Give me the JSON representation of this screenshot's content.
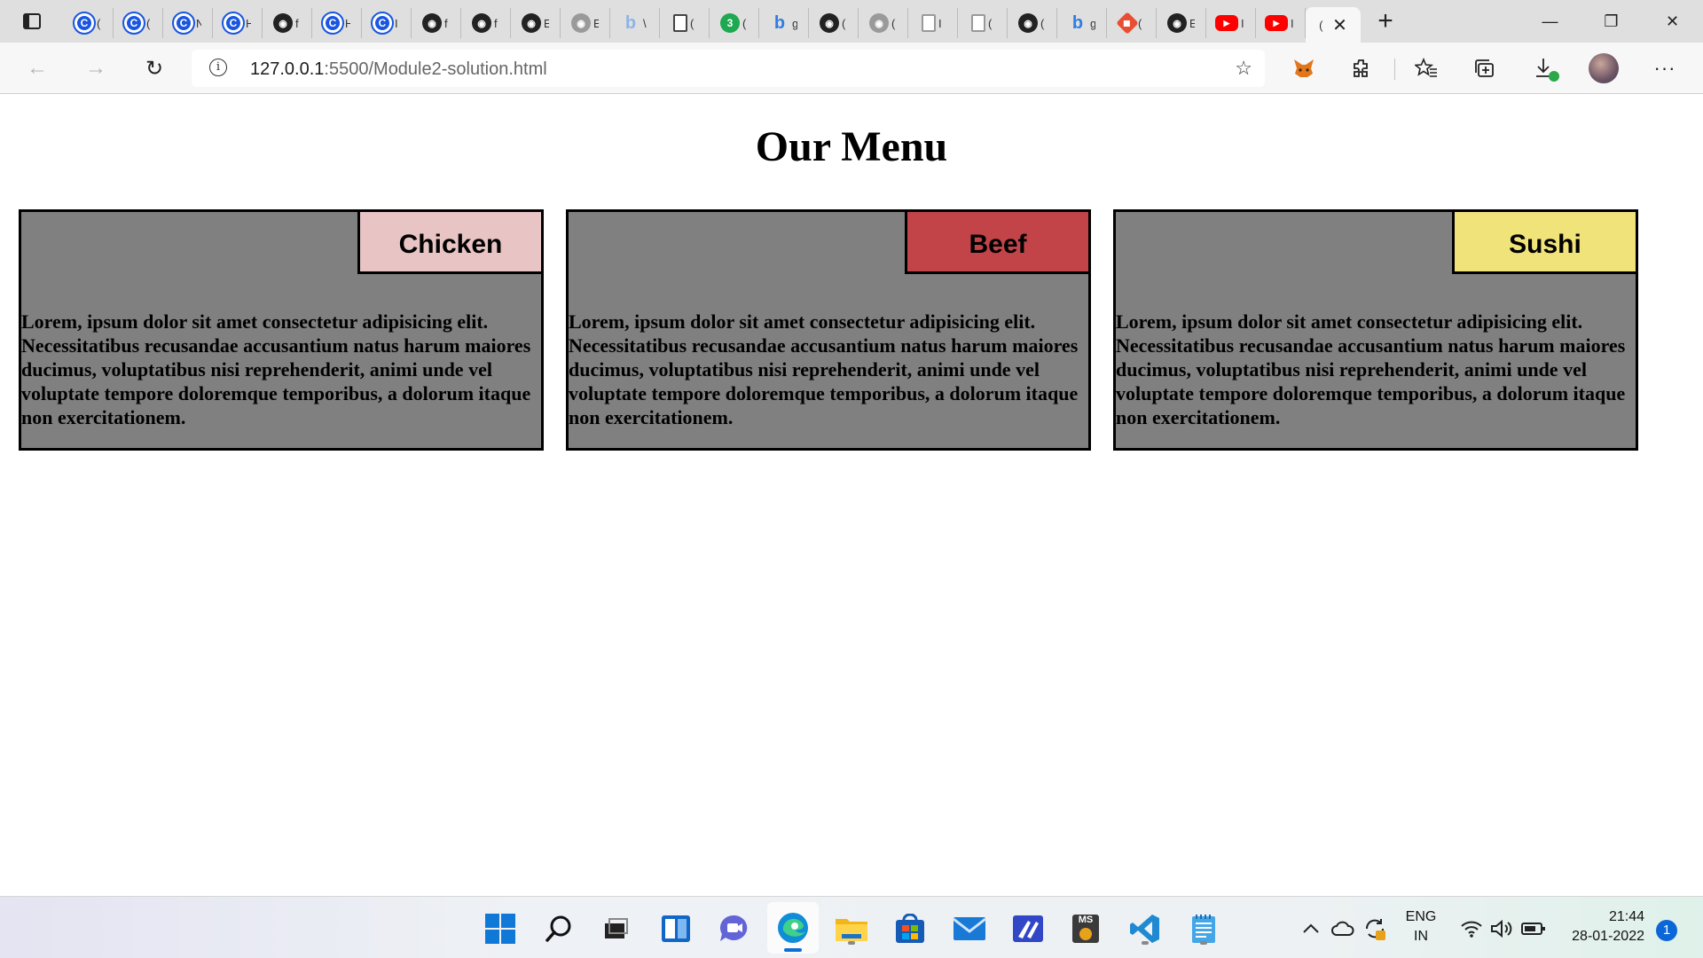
{
  "browser": {
    "tabs": [
      {
        "icon": "chrome-icon",
        "glyph": "C",
        "stub": "("
      },
      {
        "icon": "chrome-icon",
        "glyph": "C",
        "stub": "("
      },
      {
        "icon": "chrome-icon",
        "glyph": "C",
        "stub": "N"
      },
      {
        "icon": "chrome-icon",
        "glyph": "C",
        "stub": "H"
      },
      {
        "icon": "github-icon",
        "glyph": "◉",
        "stub": "f"
      },
      {
        "icon": "chrome-icon",
        "glyph": "C",
        "stub": "H"
      },
      {
        "icon": "chrome-icon",
        "glyph": "C",
        "stub": "I"
      },
      {
        "icon": "github-icon",
        "glyph": "◉",
        "stub": "f"
      },
      {
        "icon": "github-icon",
        "glyph": "◉",
        "stub": "f"
      },
      {
        "icon": "github-icon",
        "glyph": "◉",
        "stub": "E"
      },
      {
        "icon": "github-grey-icon",
        "glyph": "◉",
        "stub": "E"
      },
      {
        "icon": "bing-grey-icon",
        "glyph": "b",
        "stub": "\\"
      },
      {
        "icon": "document-icon",
        "glyph": "",
        "stub": "("
      },
      {
        "icon": "whatsapp-icon",
        "glyph": "3",
        "stub": "("
      },
      {
        "icon": "bing-icon",
        "glyph": "b",
        "stub": "g"
      },
      {
        "icon": "github-icon",
        "glyph": "◉",
        "stub": "("
      },
      {
        "icon": "github-grey-icon",
        "glyph": "◉",
        "stub": "("
      },
      {
        "icon": "document-grey-icon",
        "glyph": "",
        "stub": "I"
      },
      {
        "icon": "document-grey-icon",
        "glyph": "",
        "stub": "("
      },
      {
        "icon": "github-icon",
        "glyph": "◉",
        "stub": "("
      },
      {
        "icon": "bing-icon",
        "glyph": "b",
        "stub": "g"
      },
      {
        "icon": "git-icon",
        "glyph": "◆",
        "stub": "("
      },
      {
        "icon": "github-icon",
        "glyph": "◉",
        "stub": "E"
      },
      {
        "icon": "youtube-icon",
        "glyph": "▶",
        "stub": "I"
      },
      {
        "icon": "youtube-icon",
        "glyph": "▶",
        "stub": "I"
      }
    ],
    "active_tab_stub": "(",
    "url_host": "127.0.0.1",
    "url_rest": ":5500/Module2-solution.html"
  },
  "page": {
    "title": "Our Menu",
    "cards": [
      {
        "label": "Chicken",
        "label_color": "#e8c4c4",
        "text": "Lorem, ipsum dolor sit amet consectetur adipisicing elit. Necessitatibus recusandae accusantium natus harum maiores ducimus, voluptatibus nisi reprehenderit, animi unde vel voluptate tempore doloremque temporibus, a dolorum itaque non exercitationem."
      },
      {
        "label": "Beef",
        "label_color": "#c34448",
        "text": "Lorem, ipsum dolor sit amet consectetur adipisicing elit. Necessitatibus recusandae accusantium natus harum maiores ducimus, voluptatibus nisi reprehenderit, animi unde vel voluptate tempore doloremque temporibus, a dolorum itaque non exercitationem."
      },
      {
        "label": "Sushi",
        "label_color": "#f0e37a",
        "text": "Lorem, ipsum dolor sit amet consectetur adipisicing elit. Necessitatibus recusandae accusantium natus harum maiores ducimus, voluptatibus nisi reprehenderit, animi unde vel voluptate tempore doloremque temporibus, a dolorum itaque non exercitationem."
      }
    ],
    "card_background": "#808080"
  },
  "taskbar": {
    "language": "ENG",
    "region": "IN",
    "time": "21:44",
    "date": "28-01-2022",
    "notification_count": "1",
    "ms_app_text": "MS"
  }
}
